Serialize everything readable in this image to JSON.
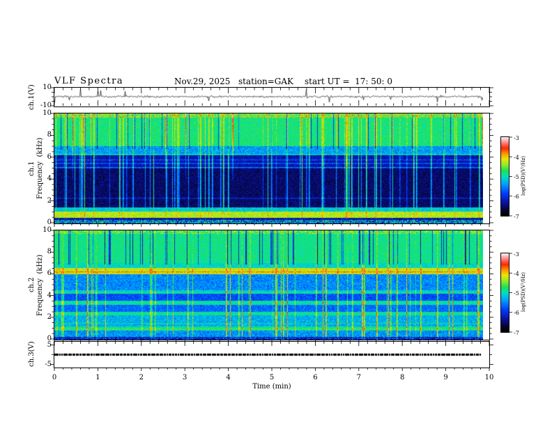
{
  "header": {
    "title": "VLF Spectra",
    "date": "Nov.29, 2025",
    "station": "station=GAK",
    "start_ut": "start UT =  17: 50: 0"
  },
  "xaxis": {
    "title": "Time  (min)",
    "tick_labels": [
      "0",
      "1",
      "2",
      "3",
      "4",
      "5",
      "6",
      "7",
      "8",
      "9",
      "10"
    ],
    "range": [
      0,
      10
    ]
  },
  "yaxes": {
    "wave": {
      "label": "ch.1(V)",
      "tick_labels": [
        "10",
        "-10"
      ],
      "range": [
        -10,
        10
      ]
    },
    "spec1": {
      "channel": "ch.1",
      "name": "Frequency  (kHz)",
      "tick_labels": [
        "10",
        "8",
        "6",
        "4",
        "2",
        "0"
      ],
      "range": [
        0,
        10
      ]
    },
    "spec2": {
      "channel": "ch.2",
      "name": "Frequency  (kHz)",
      "tick_labels": [
        "10",
        "8",
        "6",
        "4",
        "2",
        "0"
      ],
      "range": [
        0,
        10
      ]
    },
    "ch3": {
      "label": "ch.3(V)",
      "tick_labels": [
        "5",
        "-5"
      ],
      "range": [
        -5,
        5
      ]
    }
  },
  "colorbar": {
    "tick_labels": [
      "-3",
      "-4",
      "-5",
      "-6",
      "-7"
    ],
    "unit_label": "log(PSD)(V²/Hz)",
    "range": [
      -7,
      -3
    ]
  },
  "colormap": [
    [
      0.0,
      0,
      0,
      0
    ],
    [
      0.06,
      5,
      5,
      40
    ],
    [
      0.15,
      10,
      15,
      150
    ],
    [
      0.28,
      0,
      60,
      255
    ],
    [
      0.4,
      0,
      160,
      255
    ],
    [
      0.5,
      0,
      225,
      190
    ],
    [
      0.57,
      30,
      225,
      80
    ],
    [
      0.65,
      150,
      235,
      40
    ],
    [
      0.72,
      235,
      230,
      0
    ],
    [
      0.79,
      255,
      150,
      0
    ],
    [
      0.86,
      255,
      40,
      0
    ],
    [
      0.93,
      255,
      130,
      130
    ],
    [
      1.0,
      255,
      240,
      240
    ]
  ],
  "chart_data": [
    {
      "type": "line",
      "panel": "ch.1(V) waveform",
      "xlim": [
        0,
        10
      ],
      "ylim": [
        -10,
        10
      ],
      "summary": "broadband noise around 0.5 V with impulsive spikes reaching toward ±10 V, data ends near 9.85 min",
      "gen": {
        "mean_v": 0.5,
        "noise_v": 1.0,
        "spike_prob": 0.03,
        "spike_v": 8.0
      }
    },
    {
      "type": "heatmap",
      "panel": "ch.1 VLF spectrogram",
      "xlim": [
        0,
        10
      ],
      "ylim": [
        0,
        10
      ],
      "zlim": [
        -7,
        -3
      ],
      "zlabel": "log(PSD)(V²/Hz)",
      "bands": [
        [
          0.0,
          0.3,
          -5.6,
          2.2
        ],
        [
          0.3,
          0.5,
          -6.3,
          0.8
        ],
        [
          0.5,
          1.1,
          -4.3,
          0.5
        ],
        [
          1.1,
          1.45,
          -5.15,
          0.6
        ],
        [
          1.45,
          5.0,
          -6.55,
          0.5
        ],
        [
          5.0,
          6.2,
          -6.3,
          0.55
        ],
        [
          6.2,
          7.0,
          -5.4,
          0.7
        ],
        [
          7.0,
          9.6,
          -4.8,
          0.45
        ],
        [
          9.6,
          10.0,
          -4.45,
          1.3
        ]
      ],
      "lines": [
        [
          2.35,
          0.45
        ],
        [
          5.15,
          0.75
        ],
        [
          5.5,
          0.6
        ],
        [
          5.85,
          0.5
        ],
        [
          6.35,
          0.4
        ]
      ],
      "streaks": {
        "prob": 0.11,
        "min": 0.6,
        "max": 1.9,
        "bands": [
          [
            1.45,
            6.2,
            1.0
          ],
          [
            6.2,
            9.6,
            0.45
          ],
          [
            0.5,
            1.45,
            0.25
          ],
          [
            9.6,
            10,
            0.3
          ],
          [
            0,
            0.5,
            0.15
          ]
        ]
      },
      "red_streaks": {
        "prob": 0.012,
        "dpsd": 1.5,
        "f0": 4.0,
        "f1": 10.0
      },
      "dark_streaks": {
        "prob": 0.06,
        "min": 0.7,
        "max": 1.3,
        "f0": 6.8,
        "f1": 10.0
      }
    },
    {
      "type": "heatmap",
      "panel": "ch.2 VLF spectrogram",
      "xlim": [
        0,
        10
      ],
      "ylim": [
        0,
        10
      ],
      "zlim": [
        -7,
        -3
      ],
      "zlabel": "log(PSD)(V²/Hz)",
      "bands": [
        [
          0.0,
          0.25,
          -6.1,
          1.3
        ],
        [
          0.25,
          0.8,
          -5.45,
          0.75
        ],
        [
          0.8,
          1.2,
          -4.9,
          0.5
        ],
        [
          1.2,
          2.2,
          -5.3,
          0.7
        ],
        [
          2.2,
          2.55,
          -4.9,
          0.45
        ],
        [
          2.55,
          3.2,
          -5.65,
          0.6
        ],
        [
          3.2,
          3.55,
          -4.95,
          0.45
        ],
        [
          3.55,
          4.2,
          -5.8,
          0.6
        ],
        [
          4.2,
          4.55,
          -5.1,
          0.45
        ],
        [
          4.55,
          6.0,
          -5.5,
          0.7
        ],
        [
          6.0,
          6.55,
          -4.25,
          0.55
        ],
        [
          6.55,
          7.0,
          -5.05,
          0.45
        ],
        [
          7.0,
          9.7,
          -4.85,
          0.45
        ],
        [
          9.7,
          10.0,
          -4.6,
          1.1
        ]
      ],
      "lines": [
        [
          1.0,
          0.3
        ],
        [
          1.55,
          0.3
        ],
        [
          4.35,
          0.3
        ],
        [
          6.25,
          0.5
        ]
      ],
      "streaks": {
        "prob": 0.09,
        "min": 0.5,
        "max": 1.5,
        "bands": [
          [
            0.25,
            6.0,
            1.0
          ],
          [
            6.0,
            7.0,
            0.55
          ],
          [
            7.0,
            10,
            0.25
          ],
          [
            0,
            0.25,
            0.3
          ]
        ]
      },
      "red_streaks": {
        "prob": 0.005,
        "dpsd": 0.8,
        "f0": 5.9,
        "f1": 6.6
      },
      "dark_streaks": {
        "prob": 0.11,
        "min": 0.8,
        "max": 1.7,
        "f0": 6.9,
        "f1": 10.0
      }
    },
    {
      "type": "line",
      "panel": "ch.3(V)",
      "xlabel": "Time  (min)",
      "xlim": [
        0,
        10
      ],
      "ylim": [
        -5,
        5
      ],
      "value": 0,
      "x_end_min": 9.8,
      "summary": "constant 0 V thick trace from 0 to ~9.8 min"
    }
  ]
}
